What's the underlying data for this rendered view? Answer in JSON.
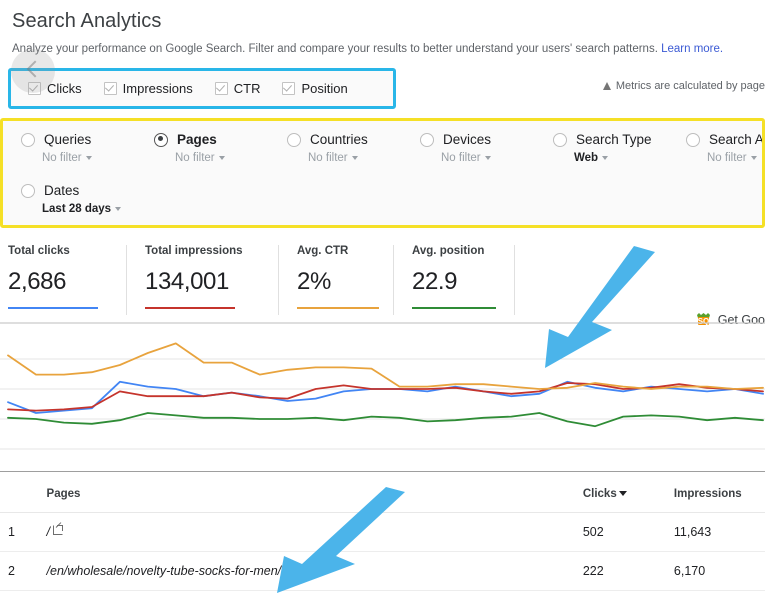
{
  "header": {
    "title": "Search Analytics",
    "subtitle": "Analyze your performance on Google Search. Filter and compare your results to better understand your users' search patterns.",
    "learn_more": "Learn more."
  },
  "metrics_bar": {
    "highlight_color": "#29b6e8",
    "note": "Metrics are calculated by page",
    "items": [
      {
        "label": "Clicks",
        "checked": true
      },
      {
        "label": "Impressions",
        "checked": true
      },
      {
        "label": "CTR",
        "checked": true
      },
      {
        "label": "Position",
        "checked": true
      }
    ]
  },
  "dimensions_panel": {
    "highlight_color": "#f5e026",
    "row1": [
      {
        "name": "Queries",
        "filter": "No filter",
        "selected": false,
        "filter_strong": false
      },
      {
        "name": "Pages",
        "filter": "No filter",
        "selected": true,
        "filter_strong": false
      },
      {
        "name": "Countries",
        "filter": "No filter",
        "selected": false,
        "filter_strong": false
      },
      {
        "name": "Devices",
        "filter": "No filter",
        "selected": false,
        "filter_strong": false
      },
      {
        "name": "Search Type",
        "filter": "Web",
        "selected": false,
        "filter_strong": true
      },
      {
        "name": "Search A",
        "filter": "No filter",
        "selected": false,
        "filter_strong": false
      }
    ],
    "row2": [
      {
        "name": "Dates",
        "filter": "Last 28 days",
        "selected": false,
        "filter_strong": true
      }
    ]
  },
  "summary_cards": [
    {
      "title": "Total clicks",
      "value": "2,686",
      "color": "#4285f4"
    },
    {
      "title": "Total impressions",
      "value": "134,001",
      "color": "#c5342c"
    },
    {
      "title": "Avg. CTR",
      "value": "2%",
      "color": "#e8a33d"
    },
    {
      "title": "Avg. position",
      "value": "22.9",
      "color": "#2f8c36"
    }
  ],
  "get_google": {
    "icon": "sq-badge-icon",
    "label": "Get Goo"
  },
  "chart_data": {
    "type": "line",
    "title": "",
    "xlabel": "",
    "ylabel": "",
    "grid": true,
    "legend": "none",
    "ylim": [
      0,
      100
    ],
    "x": [
      1,
      2,
      3,
      4,
      5,
      6,
      7,
      8,
      9,
      10,
      11,
      12,
      13,
      14,
      15,
      16,
      17,
      18,
      19,
      20,
      21,
      22,
      23,
      24,
      25,
      26,
      27,
      28
    ],
    "series": [
      {
        "name": "Clicks",
        "color": "#4285f4",
        "values": [
          39,
          30,
          32,
          34,
          56,
          52,
          50,
          44,
          47,
          44,
          40,
          42,
          48,
          50,
          50,
          48,
          52,
          48,
          44,
          46,
          56,
          51,
          48,
          52,
          50,
          48,
          50,
          46
        ]
      },
      {
        "name": "Impressions",
        "color": "#c5342c",
        "values": [
          33,
          32,
          33,
          35,
          48,
          44,
          44,
          44,
          47,
          43,
          42,
          50,
          53,
          50,
          50,
          50,
          51,
          48,
          46,
          48,
          55,
          54,
          50,
          51,
          54,
          51,
          50,
          48
        ]
      },
      {
        "name": "CTR",
        "color": "#e8a33d",
        "values": [
          78,
          62,
          62,
          64,
          70,
          80,
          88,
          72,
          72,
          62,
          66,
          68,
          68,
          67,
          52,
          52,
          54,
          54,
          52,
          50,
          51,
          55,
          52,
          50,
          52,
          52,
          50,
          51
        ]
      },
      {
        "name": "Position",
        "color": "#2f8c36",
        "values": [
          26,
          25,
          22,
          21,
          24,
          30,
          28,
          26,
          26,
          25,
          25,
          26,
          24,
          27,
          26,
          23,
          24,
          26,
          27,
          30,
          23,
          19,
          27,
          28,
          27,
          24,
          26,
          24
        ]
      }
    ]
  },
  "table": {
    "columns": [
      {
        "key": "index",
        "label": ""
      },
      {
        "key": "pages",
        "label": "Pages"
      },
      {
        "key": "clicks",
        "label": "Clicks",
        "sorted": true
      },
      {
        "key": "impressions",
        "label": "Impressions"
      }
    ],
    "rows": [
      {
        "index": "1",
        "page": "/",
        "clicks": "502",
        "impressions": "11,643"
      },
      {
        "index": "2",
        "page": "/en/wholesale/novelty-tube-socks-for-men/",
        "clicks": "222",
        "impressions": "6,170"
      }
    ]
  },
  "annotations": {
    "arrow_color": "#4bb4ea",
    "arrows": [
      {
        "name": "arrow-to-chart"
      },
      {
        "name": "arrow-to-table"
      }
    ]
  }
}
